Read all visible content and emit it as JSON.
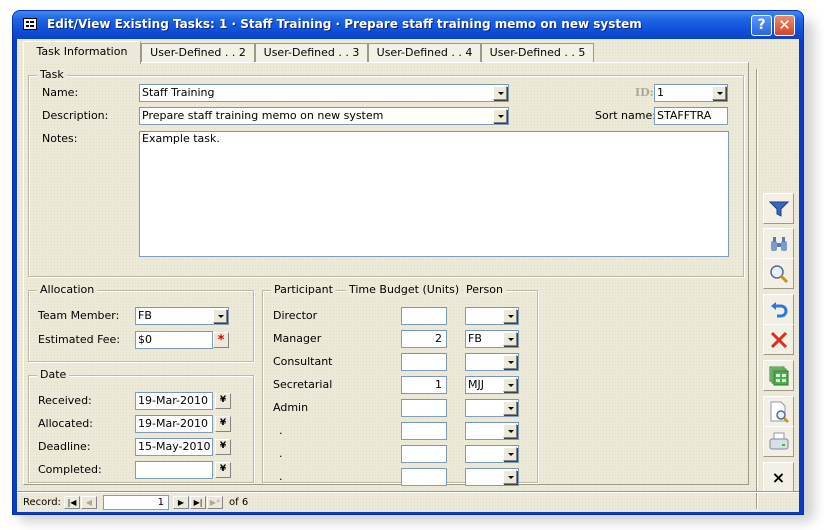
{
  "window": {
    "title": "Edit/View Existing Tasks:  1  ·  Staff Training  ·  Prepare staff training memo on new system",
    "help_icon": "help-icon",
    "close_icon": "close-icon"
  },
  "tabs": [
    {
      "label": "Task Information",
      "active": true
    },
    {
      "label": "User-Defined . . 2",
      "active": false
    },
    {
      "label": "User-Defined . . 3",
      "active": false
    },
    {
      "label": "User-Defined . . 4",
      "active": false
    },
    {
      "label": "User-Defined . . 5",
      "active": false
    }
  ],
  "task": {
    "legend": "Task",
    "name_label": "Name:",
    "name_value": "Staff Training",
    "description_label": "Description:",
    "description_value": "Prepare staff training memo on new system",
    "notes_label": "Notes:",
    "notes_value": "Example task.",
    "id_label": "ID:",
    "id_value": "1",
    "sort_name_label": "Sort name:",
    "sort_name_value": "STAFFTRA"
  },
  "allocation": {
    "legend": "Allocation",
    "team_member_label": "Team Member:",
    "team_member_value": "FB",
    "estimated_fee_label": "Estimated Fee:",
    "estimated_fee_value": "$0",
    "required_marker": "*"
  },
  "date": {
    "legend": "Date",
    "rows": [
      {
        "label": "Received:",
        "value": "19-Mar-2010"
      },
      {
        "label": "Allocated:",
        "value": "19-Mar-2010"
      },
      {
        "label": "Deadline:",
        "value": "15-May-2010"
      },
      {
        "label": "Completed:",
        "value": ""
      }
    ]
  },
  "participants": {
    "legend_participant": "Participant",
    "legend_budget": "Time Budget (Units)",
    "legend_person": "Person",
    "rows": [
      {
        "participant": "Director",
        "budget": "",
        "person": ""
      },
      {
        "participant": "Manager",
        "budget": "2",
        "person": "FB"
      },
      {
        "participant": "Consultant",
        "budget": "",
        "person": ""
      },
      {
        "participant": "Secretarial",
        "budget": "1",
        "person": "MJJ"
      },
      {
        "participant": "Admin",
        "budget": "",
        "person": ""
      },
      {
        "participant": ".",
        "budget": "",
        "person": ""
      },
      {
        "participant": ".",
        "budget": "",
        "person": ""
      },
      {
        "participant": ".",
        "budget": "",
        "person": ""
      }
    ]
  },
  "side_toolbar": [
    {
      "icon": "filter-icon"
    },
    {
      "icon": "binoculars-icon"
    },
    {
      "icon": "magnifier-icon"
    },
    {
      "icon": "undo-icon"
    },
    {
      "icon": "delete-icon"
    },
    {
      "icon": "records-icon"
    },
    {
      "icon": "print-preview-icon"
    },
    {
      "icon": "printer-icon"
    },
    {
      "icon": "close-form-icon",
      "glyph": "×"
    }
  ],
  "record_nav": {
    "label": "Record:",
    "first": "|◀",
    "prev": "◀",
    "current": "1",
    "next": "▶",
    "last": "▶|",
    "new": "▶*",
    "of_text": "of  6"
  },
  "calendar_glyph": "¥",
  "colors": {
    "titlebar": "#0f4fd9",
    "form_background": "#ece9d8",
    "required": "#e00000"
  }
}
